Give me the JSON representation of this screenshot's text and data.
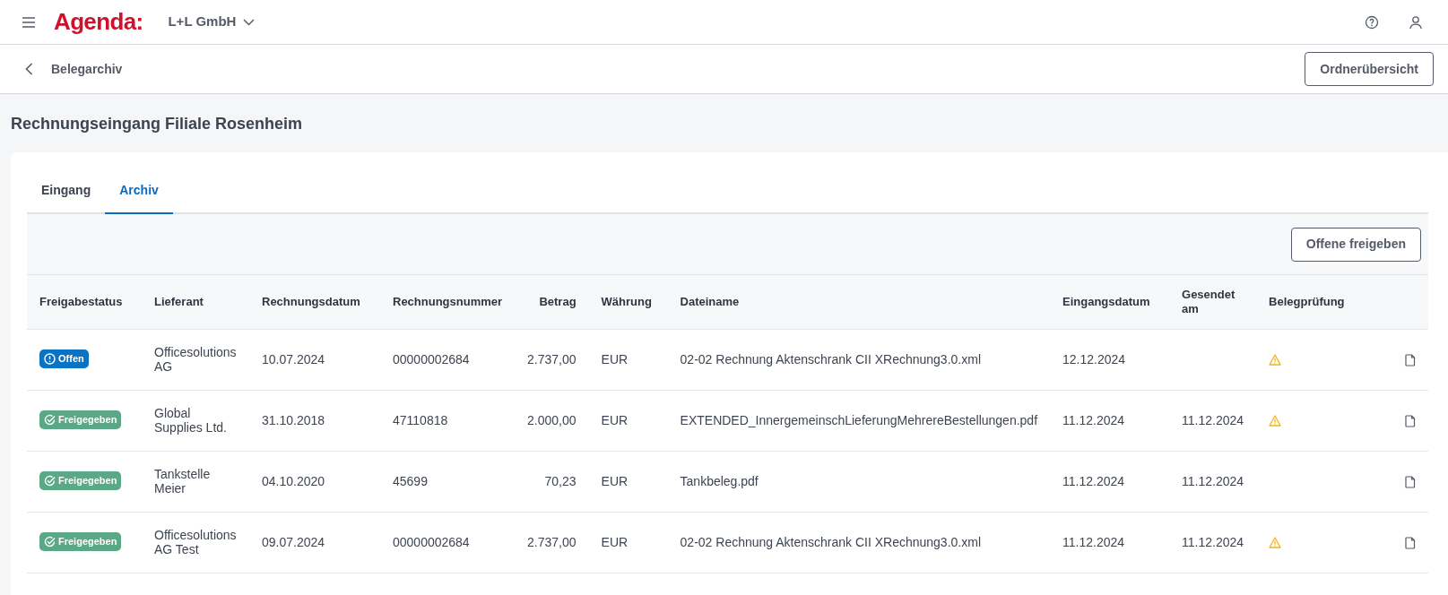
{
  "header": {
    "logo": "Agenda:",
    "company": "L+L GmbH"
  },
  "subheader": {
    "back_label": "Belegarchiv",
    "button": "Ordnerübersicht"
  },
  "page_title": "Rechnungseingang Filiale Rosenheim",
  "tabs": [
    {
      "label": "Eingang",
      "selected": false
    },
    {
      "label": "Archiv",
      "selected": true
    }
  ],
  "toolbar_button": "Offene freigeben",
  "table": {
    "columns": [
      "Freigabestatus",
      "Lieferant",
      "Rechnungsdatum",
      "Rechnungsnummer",
      "Betrag",
      "Währung",
      "Dateiname",
      "Eingangsdatum",
      "Gesendet am",
      "Belegprüfung"
    ],
    "rows": [
      {
        "status": {
          "kind": "open",
          "label": "Offen"
        },
        "supplier": "Officesolutions AG",
        "invoice_date": "10.07.2024",
        "invoice_number": "00000002684",
        "amount": "2.737,00",
        "currency": "EUR",
        "filename": "02-02 Rechnung Aktenschrank CII XRechnung3.0.xml",
        "received": "12.12.2024",
        "sent": "",
        "warning": true
      },
      {
        "status": {
          "kind": "approved",
          "label": "Freigegeben"
        },
        "supplier": "Global Supplies Ltd.",
        "invoice_date": "31.10.2018",
        "invoice_number": "47110818",
        "amount": "2.000,00",
        "currency": "EUR",
        "filename": "EXTENDED_InnergemeinschLieferungMehrereBestellungen.pdf",
        "received": "11.12.2024",
        "sent": "11.12.2024",
        "warning": true
      },
      {
        "status": {
          "kind": "approved",
          "label": "Freigegeben"
        },
        "supplier": "Tankstelle Meier",
        "invoice_date": "04.10.2020",
        "invoice_number": "45699",
        "amount": "70,23",
        "currency": "EUR",
        "filename": "Tankbeleg.pdf",
        "received": "11.12.2024",
        "sent": "11.12.2024",
        "warning": false
      },
      {
        "status": {
          "kind": "approved",
          "label": "Freigegeben"
        },
        "supplier": "Officesolutions AG Test",
        "invoice_date": "09.07.2024",
        "invoice_number": "00000002684",
        "amount": "2.737,00",
        "currency": "EUR",
        "filename": "02-02 Rechnung Aktenschrank CII XRechnung3.0.xml",
        "received": "11.12.2024",
        "sent": "11.12.2024",
        "warning": true
      }
    ]
  }
}
